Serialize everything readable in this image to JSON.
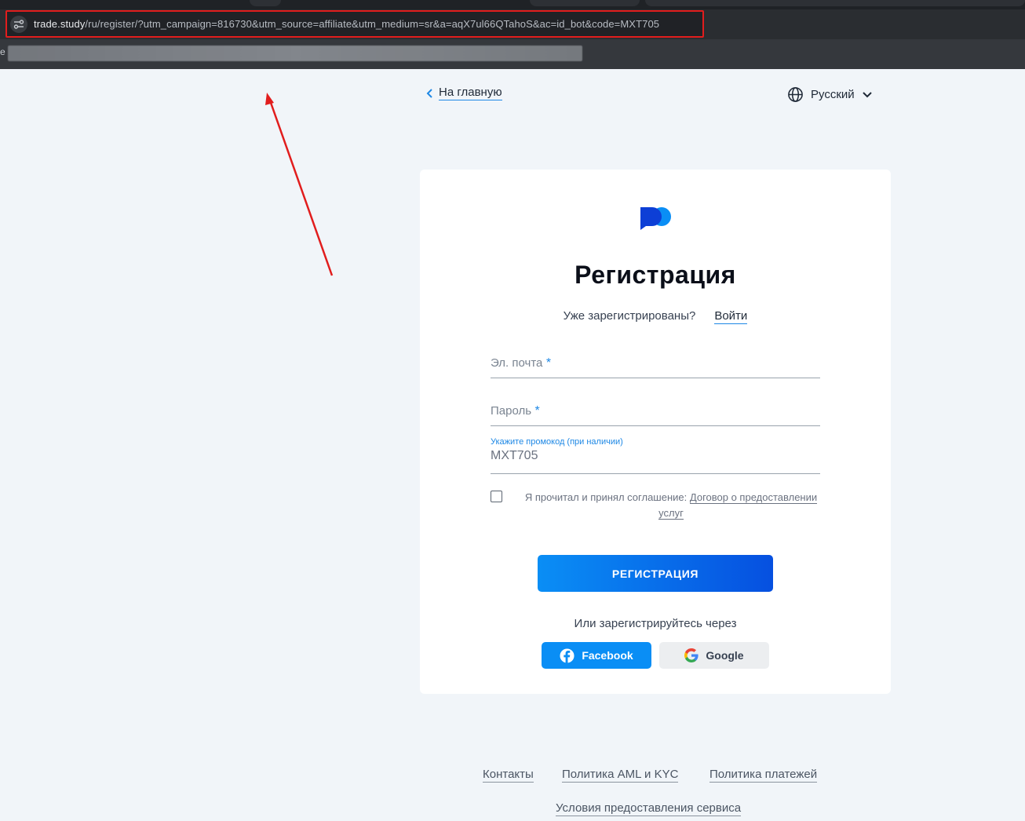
{
  "browser": {
    "url_host": "trade.study",
    "url_path": "/ru/register/?utm_campaign=816730&utm_source=affiliate&utm_medium=sr&a=aqX7ul66QTahoS&ac=id_bot&code=MXT705",
    "bookmark_letter": "e"
  },
  "nav": {
    "back_label": "На главную",
    "language": "Русский"
  },
  "form": {
    "title": "Регистрация",
    "already_registered": "Уже зарегистрированы?",
    "login_link": "Войти",
    "email_placeholder": "Эл. почта",
    "password_placeholder": "Пароль",
    "required_mark": "*",
    "promo_label": "Укажите промокод (при наличии)",
    "promo_value": "MXT705",
    "agreement_text": "Я прочитал и принял соглашение:",
    "agreement_link": "Договор о предоставлении услуг",
    "submit_label": "РЕГИСТРАЦИЯ",
    "or_text": "Или зарегистрируйтесь через",
    "facebook_label": "Facebook",
    "google_label": "Google"
  },
  "footer": {
    "contacts": "Контакты",
    "aml_kyc": "Политика AML и KYC",
    "payments": "Политика платежей",
    "terms": "Условия предоставления сервиса"
  },
  "colors": {
    "accent": "#1e88e5",
    "button_start": "#0a8ef5",
    "button_end": "#0650e0",
    "highlight": "#e11d1d"
  }
}
